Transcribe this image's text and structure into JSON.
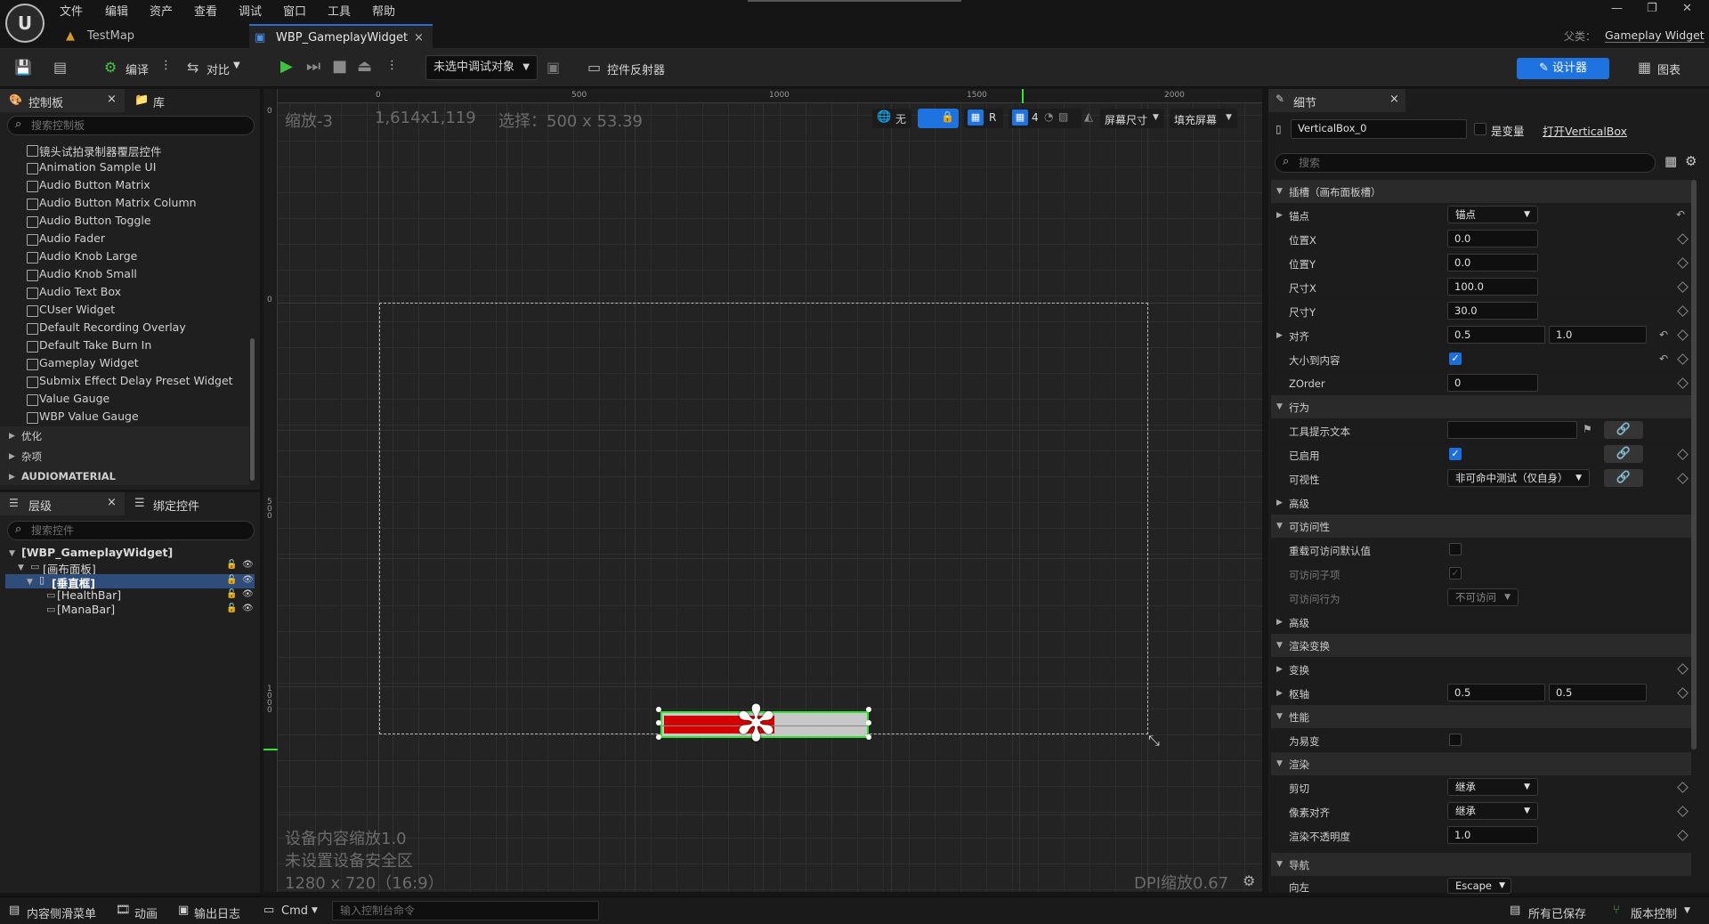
{
  "menu": [
    "文件",
    "编辑",
    "资产",
    "查看",
    "调试",
    "窗口",
    "工具",
    "帮助"
  ],
  "tabs": {
    "map": "TestMap",
    "widget": "WBP_GameplayWidget",
    "close": "×"
  },
  "parent": {
    "label": "父类：",
    "value": "Gameplay Widget"
  },
  "toolbar": {
    "compile": "编译",
    "diff": "对比",
    "debug_target": "未选中调试对象",
    "reflector": "控件反射器",
    "designer": "设计器",
    "graph": "图表"
  },
  "palette": {
    "tab": "控制板",
    "library": "库",
    "search_placeholder": "搜索控制板",
    "items": [
      "镜头试拍录制器覆层控件",
      "Animation Sample UI",
      "Audio Button Matrix",
      "Audio Button Matrix Column",
      "Audio Button Toggle",
      "Audio Fader",
      "Audio Knob Large",
      "Audio Knob Small",
      "Audio Text Box",
      "CUser Widget",
      "Default Recording Overlay",
      "Default Take Burn In",
      "Gameplay Widget",
      "Submix Effect Delay Preset Widget",
      "Value Gauge",
      "WBP Value Gauge"
    ],
    "categories": [
      "优化",
      "杂项",
      "AUDIOMATERIAL"
    ]
  },
  "hierarchy": {
    "tab": "层级",
    "bind_tab": "绑定控件",
    "search_placeholder": "搜索控件",
    "root": "[WBP_GameplayWidget]",
    "canvas": "[画布面板]",
    "vbox": "[垂直框]",
    "children": [
      "[HealthBar]",
      "[ManaBar]"
    ]
  },
  "viewport": {
    "zoom": "缩放-3",
    "size": "1,614x1,119",
    "selection": "选择：500 x 53.39",
    "ruler_top": [
      "0",
      "500",
      "1000",
      "1500",
      "2000"
    ],
    "ruler_left": [
      "0",
      "0",
      "500",
      "1000"
    ],
    "tools": {
      "none": "无",
      "r": "R",
      "grid": "4",
      "screen_size": "屏幕尺寸",
      "fill": "填充屏幕"
    },
    "info1": "设备内容缩放1.0",
    "info2": "未设置设备安全区",
    "info3": "1280 x 720（16:9）",
    "dpi": "DPI缩放0.67",
    "health_fraction": 0.55
  },
  "details": {
    "tab": "细节",
    "name": "VerticalBox_0",
    "is_variable": "是变量",
    "open": "打开VerticalBox",
    "search_placeholder": "搜索",
    "sections": {
      "slot": "插槽（画布面板槽）",
      "behavior": "行为",
      "accessibility": "可访问性",
      "render_transform": "渲染变换",
      "performance": "性能",
      "rendering": "渲染",
      "navigation": "导航"
    },
    "rows": {
      "anchor": {
        "label": "锚点",
        "value": "锚点"
      },
      "posx": {
        "label": "位置X",
        "value": "0.0"
      },
      "posy": {
        "label": "位置Y",
        "value": "0.0"
      },
      "sizex": {
        "label": "尺寸X",
        "value": "100.0"
      },
      "sizey": {
        "label": "尺寸Y",
        "value": "30.0"
      },
      "align": {
        "label": "对齐",
        "v1": "0.5",
        "v2": "1.0"
      },
      "autosize": {
        "label": "大小到内容"
      },
      "zorder": {
        "label": "ZOrder",
        "value": "0"
      },
      "tooltip": {
        "label": "工具提示文本"
      },
      "enabled": {
        "label": "已启用"
      },
      "visibility": {
        "label": "可视性",
        "value": "非可命中测试（仅自身）"
      },
      "advanced": {
        "label": "高级"
      },
      "override": {
        "label": "重载可访问默认值"
      },
      "children": {
        "label": "可访问子项"
      },
      "behaviour": {
        "label": "可访问行为",
        "value": "不可访问"
      },
      "advanced2": {
        "label": "高级"
      },
      "transform": {
        "label": "变换"
      },
      "pivot": {
        "label": "枢轴",
        "v1": "0.5",
        "v2": "0.5"
      },
      "volatile": {
        "label": "为易变"
      },
      "clipping": {
        "label": "剪切",
        "value": "继承"
      },
      "pixelsnap": {
        "label": "像素对齐",
        "value": "继承"
      },
      "opacity": {
        "label": "渲染不透明度",
        "value": "1.0"
      },
      "left": {
        "label": "向左",
        "value": "Escape"
      }
    }
  },
  "statusbar": {
    "drawer": "内容侧滑菜单",
    "anim": "动画",
    "log": "输出日志",
    "cmd": "Cmd",
    "console_placeholder": "输入控制台命令",
    "saved": "所有已保存",
    "vc": "版本控制"
  },
  "colors": {
    "accent": "#1f73e0",
    "health": "#d40000",
    "selection": "#2fe62f"
  }
}
